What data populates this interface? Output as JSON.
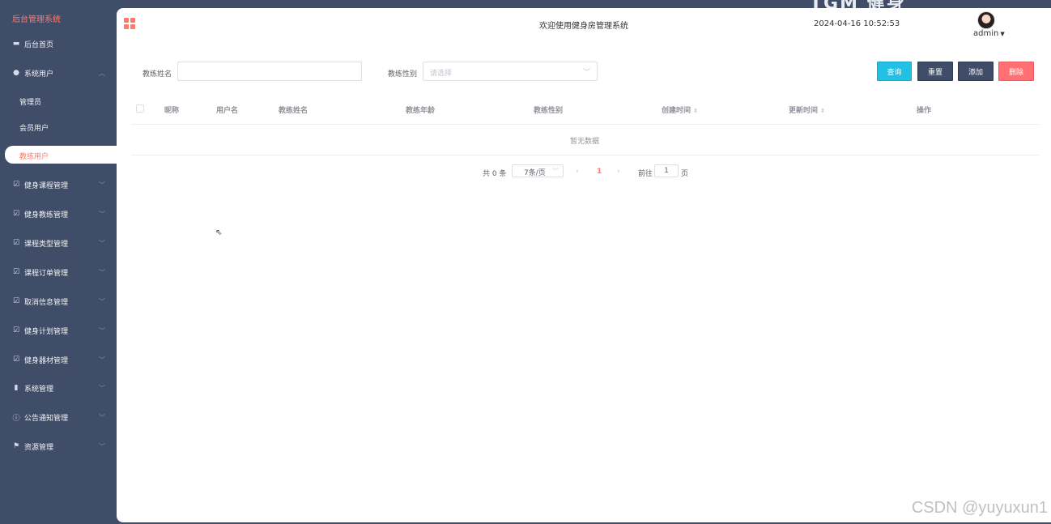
{
  "sidebar": {
    "title": "后台管理系统",
    "home": "后台首页",
    "system_users": {
      "label": "系统用户",
      "children": [
        "管理员",
        "会员用户"
      ],
      "active": "教练用户"
    },
    "groups": [
      {
        "label": "健身课程管理"
      },
      {
        "label": "健身教练管理"
      },
      {
        "label": "课程类型管理"
      },
      {
        "label": "课程订单管理"
      },
      {
        "label": "取消信息管理"
      },
      {
        "label": "健身计划管理"
      },
      {
        "label": "健身器材管理"
      },
      {
        "label": "系统管理"
      },
      {
        "label": "公告通知管理"
      },
      {
        "label": "资源管理"
      }
    ]
  },
  "header": {
    "welcome": "欢迎使用健身房管理系统",
    "datetime": "2024-04-16 10:52:53",
    "username": "admin"
  },
  "filters": {
    "name_label": "教练姓名",
    "name_value": "",
    "gender_label": "教练性别",
    "gender_placeholder": "请选择"
  },
  "buttons": {
    "query": "查询",
    "reset": "重置",
    "add": "添加",
    "delete": "删除",
    "colors": {
      "query": "#23c0e6",
      "reset": "#3f4d69",
      "add": "#3f4d69",
      "delete": "#ff6f73"
    }
  },
  "table": {
    "columns": [
      "昵称",
      "用户名",
      "教练姓名",
      "教练年龄",
      "教练性别",
      "创建时间",
      "更新时间",
      "操作"
    ],
    "empty_text": "暂无数据"
  },
  "pagination": {
    "total": "共 0 条",
    "page_size": "7条/页",
    "current": "1",
    "goto_label": "前往",
    "goto_value": "1",
    "page_unit": "页"
  },
  "watermark": "CSDN @yuyuxun1",
  "theme": {
    "sidebar_bg": "#3f4d69",
    "accent": "#ff7c6b"
  }
}
